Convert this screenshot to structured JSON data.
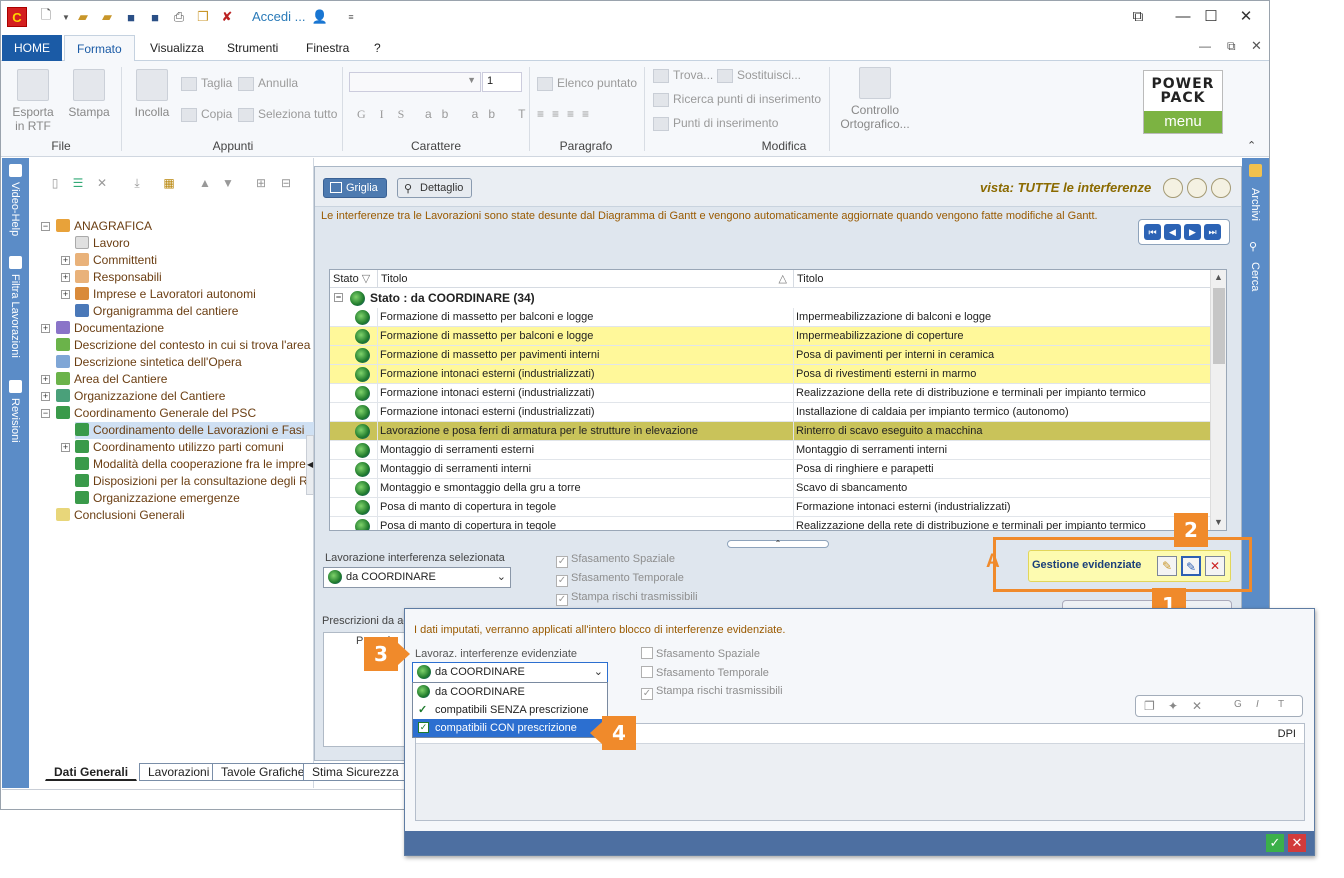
{
  "titlebar": {
    "accedi": "Accedi ...",
    "app_letter": "C"
  },
  "tabs": [
    "HOME",
    "Formato",
    "Visualizza",
    "Strumenti",
    "Finestra",
    "?"
  ],
  "ribbon": {
    "file": {
      "label": "File",
      "export": "Esporta in RTF",
      "print": "Stampa"
    },
    "appunti": {
      "label": "Appunti",
      "incolla": "Incolla",
      "taglia": "Taglia",
      "annulla": "Annulla",
      "copia": "Copia",
      "seleziona": "Seleziona tutto"
    },
    "carattere": {
      "label": "Carattere",
      "size": "1"
    },
    "paragrafo": {
      "label": "Paragrafo",
      "elenco": "Elenco puntato"
    },
    "modifica": {
      "label": "Modifica",
      "trova": "Trova...",
      "sostituisci": "Sostituisci...",
      "ricerca": "Ricerca punti di inserimento",
      "punti": "Punti di inserimento",
      "controllo": "Controllo Ortografico..."
    },
    "powerpack": {
      "l1": "POWER",
      "l2": "PACK",
      "l3": "menu"
    }
  },
  "leftbar": {
    "videohelp": "Video-Help",
    "filtra": "Filtra Lavorazioni",
    "revisioni": "Revisioni"
  },
  "rightbar": {
    "archivi": "Archivi",
    "cerca": "Cerca"
  },
  "tree": [
    "ANAGRAFICA",
    "Lavoro",
    "Committenti",
    "Responsabili",
    "Imprese e Lavoratori autonomi",
    "Organigramma del cantiere",
    "Documentazione",
    "Descrizione del contesto in cui si trova l'area de",
    "Descrizione sintetica dell'Opera",
    "Area del Cantiere",
    "Organizzazione del Cantiere",
    "Coordinamento Generale del PSC",
    "Coordinamento delle Lavorazioni e Fasi",
    "Coordinamento utilizzo parti comuni",
    "Modalità della cooperazione fra le imprese",
    "Disposizioni per la consultazione degli RLS",
    "Organizzazione emergenze",
    "Conclusioni Generali"
  ],
  "bottom_tabs": [
    "Dati Generali",
    "Lavorazioni",
    "Tavole Grafiche",
    "Stima Sicurezza"
  ],
  "main": {
    "griglia": "Griglia",
    "dettaglio": "Dettaglio",
    "vista": "vista: TUTTE le interferenze",
    "info": "Le interferenze  tra le Lavorazioni sono state desunte dal Diagramma di Gantt e vengono automaticamente aggiornate quando vengono fatte modifiche al Gantt.",
    "col_stato": "Stato",
    "col_titolo1": "Titolo",
    "col_titolo2": "Titolo",
    "group": "Stato : da COORDINARE (34)",
    "rows": [
      [
        "Formazione di massetto per balconi e logge",
        "Impermeabilizzazione di balconi e logge"
      ],
      [
        "Formazione di massetto per balconi e logge",
        "Impermeabilizzazione di coperture"
      ],
      [
        "Formazione di massetto per pavimenti interni",
        "Posa di pavimenti per interni in ceramica"
      ],
      [
        "Formazione intonaci esterni (industrializzati)",
        "Posa di rivestimenti esterni in marmo"
      ],
      [
        "Formazione intonaci esterni (industrializzati)",
        "Realizzazione della rete di distribuzione e terminali per impianto termico"
      ],
      [
        "Formazione intonaci esterni (industrializzati)",
        "Installazione di caldaia per impianto termico (autonomo)"
      ],
      [
        "Lavorazione e posa ferri di armatura per le strutture in elevazione",
        "Rinterro di scavo eseguito a macchina"
      ],
      [
        "Montaggio di serramenti esterni",
        "Montaggio di serramenti interni"
      ],
      [
        "Montaggio di serramenti interni",
        "Posa di ringhiere e parapetti"
      ],
      [
        "Montaggio e smontaggio della gru a torre",
        "Scavo di sbancamento"
      ],
      [
        "Posa di manto di copertura in tegole",
        "Formazione intonaci esterni (industrializzati)"
      ],
      [
        "Posa di manto di copertura in tegole",
        "Realizzazione della rete di distribuzione e terminali per impianto termico"
      ]
    ],
    "sel_label": "Lavorazione interferenza selezionata",
    "sel_value": "da COORDINARE",
    "sfas_spaziale": "Sfasamento Spaziale",
    "sfas_temporale": "Sfasamento Temporale",
    "stampa_rischi": "Stampa rischi trasmissibili",
    "prescrizioni": "Prescrizioni da ad",
    "prescr_col": "Prescri",
    "gestione": "Gestione evidenziate"
  },
  "callouts": {
    "a": "A",
    "n1": "1",
    "n2": "2",
    "n3": "3",
    "n4": "4"
  },
  "dialog": {
    "info": "I dati imputati, verranno applicati all'intero blocco di interferenze evidenziate.",
    "label": "Lavoraz. interferenze evidenziate",
    "value": "da COORDINARE",
    "options": [
      "da COORDINARE",
      "compatibili SENZA prescrizione",
      "compatibili CON prescrizione"
    ],
    "sfas_spaziale": "Sfasamento Spaziale",
    "sfas_temporale": "Sfasamento Temporale",
    "stampa_rischi": "Stampa rischi trasmissibili",
    "dpi": "DPI"
  },
  "colors": {
    "accent": "#1b5ba6",
    "side": "#5b8cc7",
    "highlight": "#fff89a",
    "selected": "#c9c35a",
    "callout": "#f08a2b"
  }
}
